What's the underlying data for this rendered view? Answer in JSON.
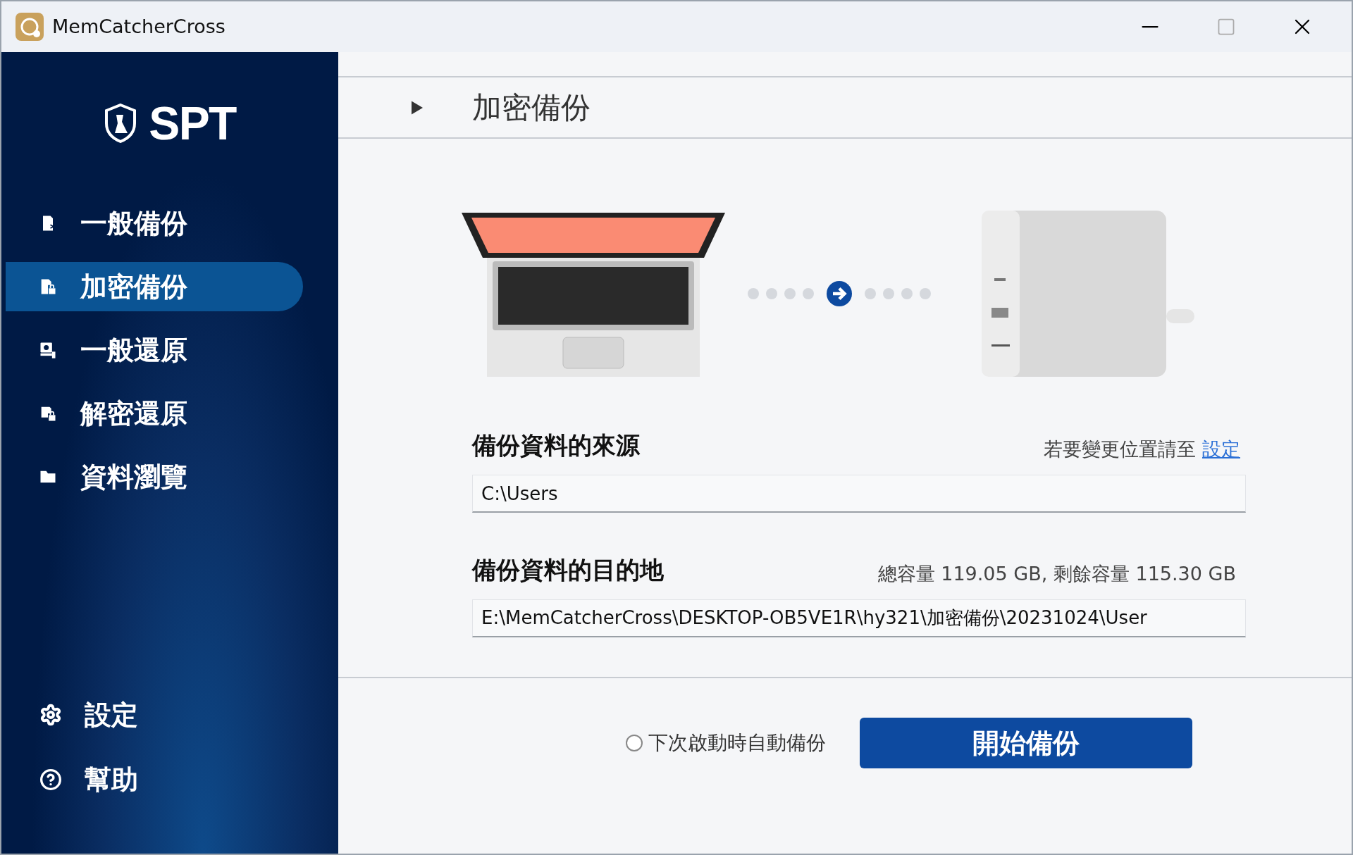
{
  "window": {
    "title": "MemCatcherCross"
  },
  "sidebar": {
    "logo_text": "SPT",
    "items": [
      {
        "label": "一般備份",
        "kind": "backup",
        "selected": false
      },
      {
        "label": "加密備份",
        "kind": "encrypt",
        "selected": true
      },
      {
        "label": "一般還原",
        "kind": "restore",
        "selected": false
      },
      {
        "label": "解密還原",
        "kind": "decrypt",
        "selected": false
      },
      {
        "label": "資料瀏覽",
        "kind": "browse",
        "selected": false
      }
    ],
    "bottom_items": [
      {
        "label": "設定",
        "kind": "settings"
      },
      {
        "label": "幫助",
        "kind": "help"
      }
    ]
  },
  "header": {
    "title": "加密備份"
  },
  "source": {
    "label": "備份資料的來源",
    "hint": "若要變更位置請至",
    "link": "設定",
    "value": "C:\\Users"
  },
  "destination": {
    "label": "備份資料的目的地",
    "capacity": "總容量 119.05 GB, 剩餘容量 115.30 GB",
    "value": "E:\\MemCatcherCross\\DESKTOP-OB5VE1R\\hy321\\加密備份\\20231024\\User"
  },
  "auto_backup": {
    "label": "下次啟動時自動備份",
    "checked": false
  },
  "start_button": {
    "label": "開始備份"
  }
}
